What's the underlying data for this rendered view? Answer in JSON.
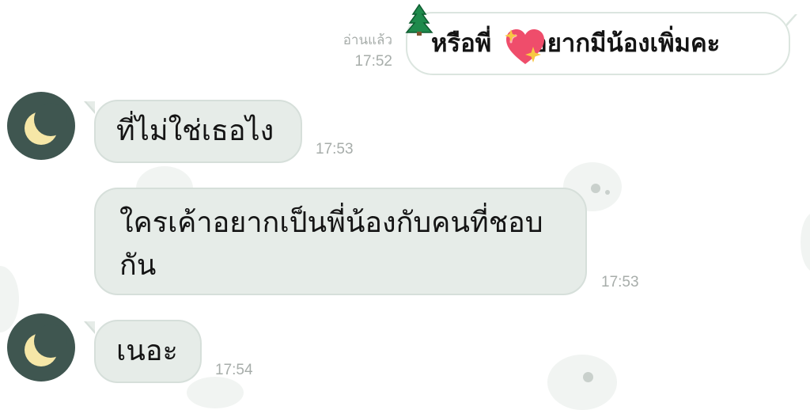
{
  "chat": {
    "messages": [
      {
        "direction": "outgoing",
        "text": "หรือพี่ ❤ อยากมีน้องเพิ่มคะ",
        "read_label": "อ่านแล้ว",
        "time": "17:52"
      },
      {
        "direction": "incoming",
        "text": "ที่ไม่ใช่เธอไง",
        "time": "17:53"
      },
      {
        "direction": "incoming",
        "text": "ใครเค้าอยากเป็นพี่น้องกับคนที่ชอบกัน",
        "time": "17:53"
      },
      {
        "direction": "incoming",
        "text": "เนอะ",
        "time": "17:54"
      }
    ],
    "avatar_icon": "crescent-moon-icon",
    "decor_stickers": [
      "tree-icon",
      "heart-icon",
      "sparkle-icon"
    ],
    "colors": {
      "incoming_bubble": "#e6ece8",
      "outgoing_bubble": "#ffffff",
      "bubble_border": "#d6dfda",
      "avatar_bg": "#3f5650",
      "moon": "#f6e7a7",
      "time_text": "#a7adaa",
      "heart": "#ef4d6b"
    }
  }
}
